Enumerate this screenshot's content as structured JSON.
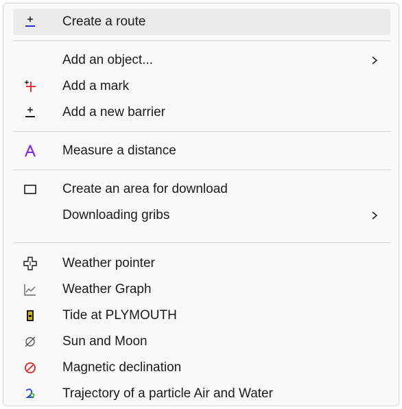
{
  "menu": {
    "items": [
      {
        "label": "Create a route",
        "icon": "route-icon"
      },
      {
        "label": "Add an object...",
        "icon": "",
        "submenu": true
      },
      {
        "label": "Add a mark",
        "icon": "mark-icon"
      },
      {
        "label": "Add a new barrier",
        "icon": "barrier-icon"
      },
      {
        "label": "Measure a distance",
        "icon": "measure-icon"
      },
      {
        "label": "Create an area for download",
        "icon": "area-icon"
      },
      {
        "label": "Downloading gribs",
        "icon": "",
        "submenu": true
      },
      {
        "label": "Weather pointer",
        "icon": "weather-pointer-icon"
      },
      {
        "label": "Weather Graph",
        "icon": "weather-graph-icon"
      },
      {
        "label": "Tide at PLYMOUTH",
        "icon": "tide-icon"
      },
      {
        "label": "Sun and Moon",
        "icon": "sun-moon-icon"
      },
      {
        "label": "Magnetic declination",
        "icon": "magnetic-icon"
      },
      {
        "label": "Trajectory of a particle Air and Water",
        "icon": "trajectory-icon"
      }
    ]
  },
  "colors": {
    "route_icon": "#2b2bd6",
    "mark_icon": "#e02020",
    "measure_icon": "#8a2be2",
    "tide_icon": "#d4b800",
    "magnetic_icon": "#e02020",
    "trajectory_icon": "#1e3fd6",
    "trajectory_icon_accent": "#2ca02c",
    "highlight": "#ebebeb"
  }
}
